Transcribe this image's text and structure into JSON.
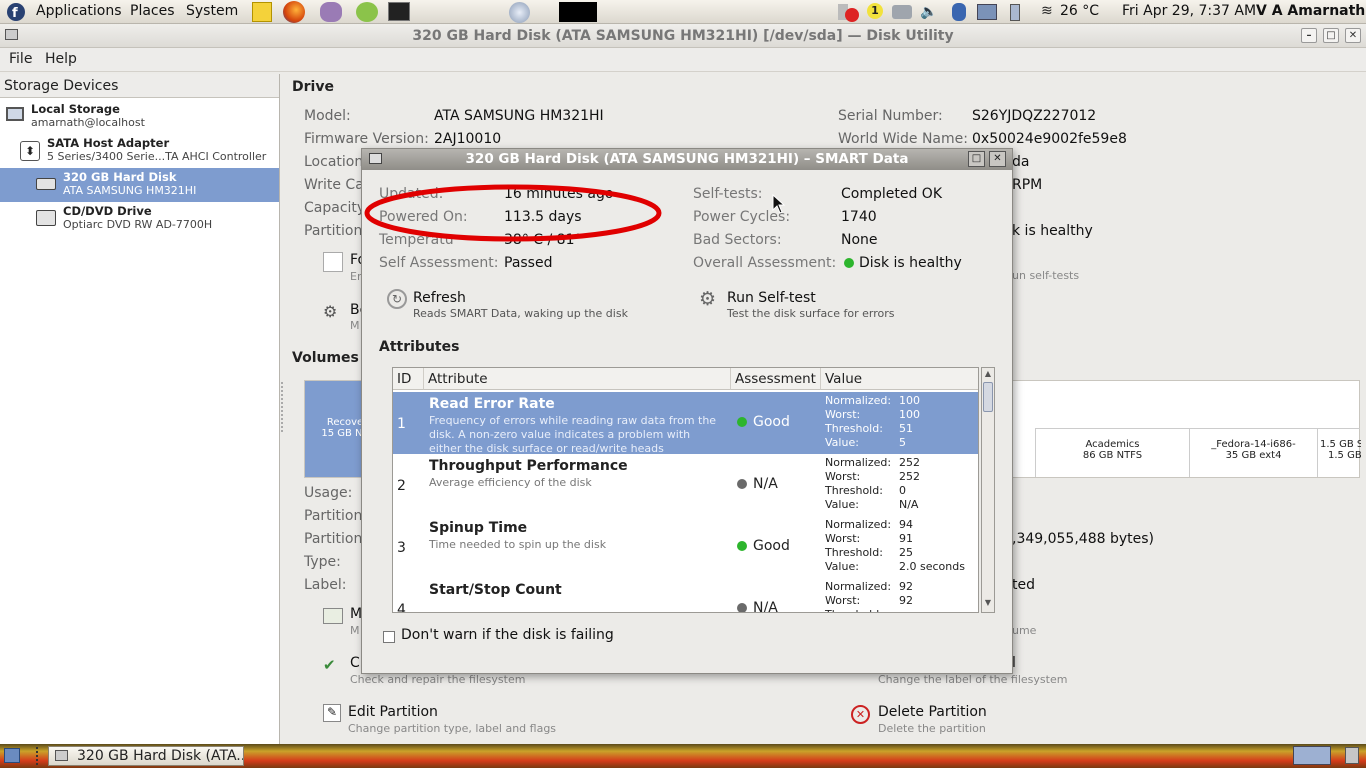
{
  "top_panel": {
    "menus": [
      "Applications",
      "Places",
      "System"
    ],
    "weather": "26 °C",
    "clock": "Fri Apr 29,  7:37 AM",
    "user": "V A Amarnath",
    "badge": "1"
  },
  "window": {
    "title": "320 GB Hard Disk (ATA SAMSUNG HM321HI) [/dev/sda] — Disk Utility",
    "menu": [
      "File",
      "Help"
    ]
  },
  "sidebar": {
    "header": "Storage Devices",
    "items": [
      {
        "title": "Local Storage",
        "sub": "amarnath@localhost",
        "icon": "computer-icon"
      },
      {
        "title": "SATA Host Adapter",
        "sub": "5 Series/3400 Serie...TA AHCI Controller",
        "icon": "adapter-icon"
      },
      {
        "title": "320 GB Hard Disk",
        "sub": "ATA SAMSUNG HM321HI",
        "icon": "harddisk-icon"
      },
      {
        "title": "CD/DVD Drive",
        "sub": "Optiarc DVD RW AD-7700H",
        "icon": "optical-drive-icon"
      }
    ]
  },
  "drive": {
    "heading": "Drive",
    "model_label": "Model:",
    "model": "ATA SAMSUNG HM321HI",
    "firmware_label": "Firmware Version:",
    "firmware": "2AJ10010",
    "location_label": "Location:",
    "writecache_label": "Write Cac",
    "capacity_label": "Capacity",
    "partitioning_label": "Partitioni",
    "serial_label": "Serial Number:",
    "serial": "S26YJDQZ227012",
    "wwn_label": "World Wide Name:",
    "wwn": "0x50024e9002fe59e8",
    "device_partial": "da",
    "rpm_partial": "RPM",
    "health_partial": "k is healthy",
    "selftest_partial": "un self-tests",
    "fo_partial": "Fo",
    "fo_sub": "Er",
    "be_partial": "Be",
    "be_sub": "M"
  },
  "volumes": {
    "heading": "Volumes",
    "segments": [
      {
        "name": "Recove",
        "size": "15 GB NT"
      },
      {
        "name": "Academics",
        "size": "86 GB NTFS"
      },
      {
        "name": "_Fedora-14-i686-",
        "size": "35 GB ext4"
      },
      {
        "name": "1.5 GB Swa...",
        "size": "1.5 GB"
      }
    ],
    "usage_label": "Usage:",
    "partition_label": "Partition",
    "partition2_label": "Partition",
    "type_label": "Type:",
    "label_label": "Label:",
    "bytes_partial": ",349,055,488 bytes)",
    "mounted_partial": "ted",
    "m_partial": "M",
    "m_sub": "M",
    "volume_partial": "ume",
    "check_partial": "Cl",
    "check_sub": "Check and repair the filesystem",
    "label_btn_partial": "l",
    "label_btn_sub": "Change the label of the filesystem",
    "edit": "Edit Partition",
    "edit_sub": "Change partition type, label and flags",
    "delete": "Delete Partition",
    "delete_sub": "Delete the partition"
  },
  "smart": {
    "title": "320 GB Hard Disk (ATA SAMSUNG HM321HI) – SMART Data",
    "updated_label": "Updated:",
    "updated": "16 minutes ago",
    "powered_label": "Powered On:",
    "powered": "113.5 days",
    "temp_label": "Temperatu",
    "temp": "38° C / 81°",
    "self_label": "Self Assessment:",
    "self": "Passed",
    "selftests_label": "Self-tests:",
    "selftests": "Completed OK",
    "cycles_label": "Power Cycles:",
    "cycles": "1740",
    "bad_label": "Bad Sectors:",
    "bad": "None",
    "overall_label": "Overall Assessment:",
    "overall": "Disk is healthy",
    "refresh": "Refresh",
    "refresh_sub": "Reads SMART Data, waking up the disk",
    "run": "Run Self-test",
    "run_sub": "Test the disk surface for errors",
    "attributes_heading": "Attributes",
    "columns": [
      "ID",
      "Attribute",
      "Assessment",
      "Value"
    ],
    "value_keys": [
      "Normalized:",
      "Worst:",
      "Threshold:",
      "Value:"
    ],
    "rows": [
      {
        "id": "1",
        "name": "Read Error Rate",
        "desc": "Frequency of errors while reading raw data from the disk. A non-zero value indicates a problem with either the disk surface or read/write heads",
        "assess": "Good",
        "color": "#2db52d",
        "v": [
          "100",
          "100",
          "51",
          "5"
        ]
      },
      {
        "id": "2",
        "name": "Throughput Performance",
        "desc": "Average efficiency of the disk",
        "assess": "N/A",
        "color": "#6a6a6a",
        "v": [
          "252",
          "252",
          "0",
          "N/A"
        ]
      },
      {
        "id": "3",
        "name": "Spinup Time",
        "desc": "Time needed to spin up the disk",
        "assess": "Good",
        "color": "#2db52d",
        "v": [
          "94",
          "91",
          "25",
          "2.0 seconds"
        ]
      },
      {
        "id": "4",
        "name": "Start/Stop Count",
        "desc": "",
        "assess": "N/A",
        "color": "#6a6a6a",
        "v": [
          "92",
          "92",
          "",
          ""
        ]
      }
    ],
    "dont_warn": "Don't warn if the disk is failing"
  },
  "taskbar": {
    "task": "320 GB Hard Disk (ATA..."
  },
  "colors": {
    "selection": "#7e9ccf",
    "annotation": "#e00000",
    "good": "#2db52d"
  }
}
